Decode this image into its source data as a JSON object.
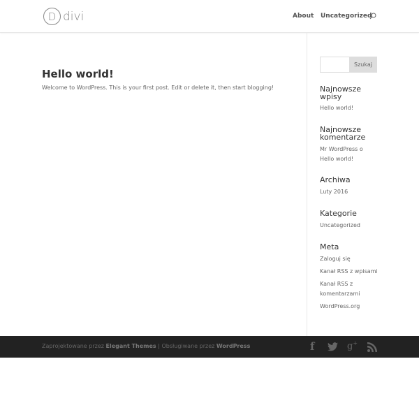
{
  "header": {
    "logo_letter": "D",
    "logo_text": "divi",
    "nav": [
      "About",
      "Uncategorized"
    ],
    "search_icon": "search-icon"
  },
  "post": {
    "title": "Hello world!",
    "excerpt": "Welcome to WordPress. This is your first post. Edit or delete it, then start blogging!"
  },
  "sidebar": {
    "search_button": "Szukaj",
    "widgets": [
      {
        "title": "Najnowsze wpisy",
        "items": [
          "Hello world!"
        ]
      },
      {
        "title": "Najnowsze komentarze",
        "items": [
          "Mr WordPress o Hello world!"
        ]
      },
      {
        "title": "Archiwa",
        "items": [
          "Luty 2016"
        ]
      },
      {
        "title": "Kategorie",
        "items": [
          "Uncategorized"
        ]
      },
      {
        "title": "Meta",
        "items": [
          "Zaloguj się",
          "Kanał RSS z wpisami",
          "Kanał RSS z komentarzami",
          "WordPress.org"
        ]
      }
    ]
  },
  "footer": {
    "designed_by": "Zaprojektowane przez ",
    "elegant": "Elegant Themes",
    "powered": " | Obsługiwane przez ",
    "wordpress": "WordPress",
    "social": [
      "facebook-icon",
      "twitter-icon",
      "google-plus-icon",
      "rss-icon"
    ]
  }
}
